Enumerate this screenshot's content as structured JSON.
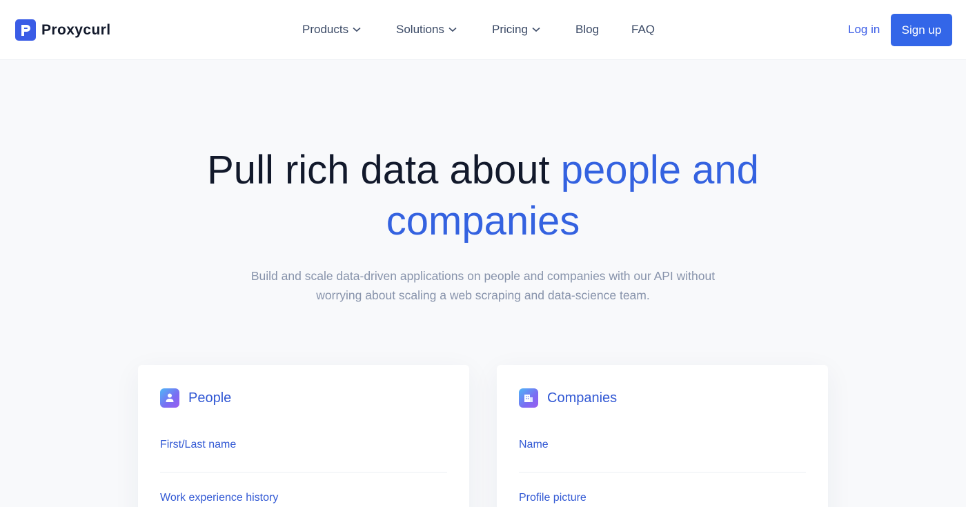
{
  "brand": {
    "name": "Proxycurl"
  },
  "nav": {
    "items": [
      {
        "label": "Products",
        "has_dropdown": true
      },
      {
        "label": "Solutions",
        "has_dropdown": true
      },
      {
        "label": "Pricing",
        "has_dropdown": true
      },
      {
        "label": "Blog",
        "has_dropdown": false
      },
      {
        "label": "FAQ",
        "has_dropdown": false
      }
    ],
    "login_label": "Log in",
    "signup_label": "Sign up"
  },
  "hero": {
    "title_plain": "Pull rich data about",
    "title_accent_line1": "people and",
    "title_accent_line2": "companies",
    "subtitle": "Build and scale data-driven applications on people and companies with our API without worrying about scaling a web scraping and data-science team."
  },
  "cards": [
    {
      "title": "People",
      "icon": "person-icon",
      "fields": [
        "First/Last name",
        "Work experience history"
      ]
    },
    {
      "title": "Companies",
      "icon": "building-icon",
      "fields": [
        "Name",
        "Profile picture"
      ]
    }
  ],
  "colors": {
    "accent": "#3462e0",
    "signup_bg": "#3366e8",
    "page_bg": "#f8f9fb",
    "muted_text": "#8793ab"
  }
}
